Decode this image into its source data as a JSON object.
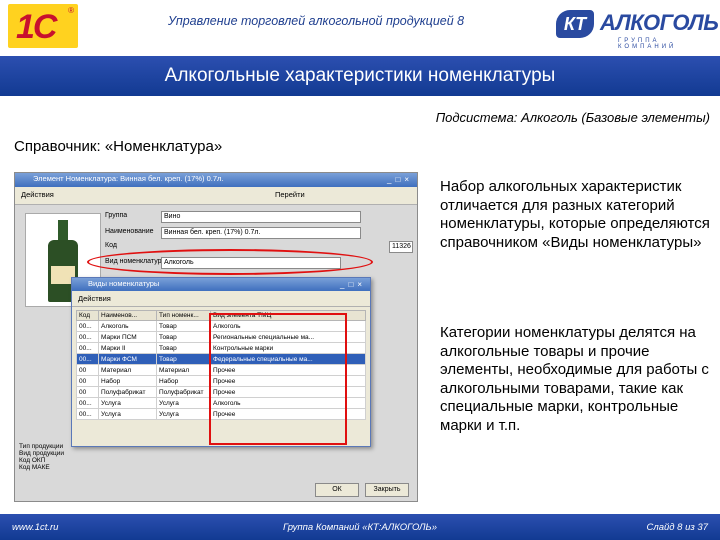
{
  "header": {
    "app_title": "Управление торговлей алкогольной продукцией 8",
    "logo_1c": "1С",
    "logo_kt_badge": "КТ",
    "logo_kt_word": "АЛКОГОЛЬ",
    "logo_kt_sub": "ГРУППА КОМПАНИЙ"
  },
  "page_title": "Алкогольные характеристики номенклатуры",
  "subsystem": "Подсистема: Алкоголь (Базовые элементы)",
  "reference": "Справочник: «Номенклатура»",
  "screenshot": {
    "main_window_title": "Элемент Номенклатура: Винная бел. креп. (17%) 0.7л.",
    "toolbar_actions": "Действия",
    "toolbar_goto": "Перейти",
    "fields": [
      {
        "label": "Группа",
        "value": "Вино"
      },
      {
        "label": "Наименование",
        "value": "Винная бел. креп. (17%) 0.7л."
      },
      {
        "label": "Код",
        "value": "11326"
      },
      {
        "label": "Вид номенклатуры",
        "value": "Алкоголь"
      }
    ],
    "kinds_window_title": "Виды номенклатуры",
    "kinds_toolbar": "Действия",
    "kinds_table": {
      "headers": [
        "Код",
        "Наименов...",
        "Тип номенк...",
        "Вид элемента ТМЦ"
      ],
      "rows": [
        [
          "00...",
          "Алкоголь",
          "Товар",
          "Алкоголь"
        ],
        [
          "00...",
          "Марки ПСМ",
          "Товар",
          "Региональные специальные ма..."
        ],
        [
          "00...",
          "Марки II",
          "Товар",
          "Контрольные марки"
        ],
        [
          "00...",
          "Марки ФСМ",
          "Товар",
          "Федеральные специальные ма..."
        ],
        [
          "00",
          "Материал",
          "Материал",
          "Прочее"
        ],
        [
          "00",
          "Набор",
          "Набор",
          "Прочее"
        ],
        [
          "00",
          "Полуфабрикат",
          "Полуфабрикат",
          "Прочее"
        ],
        [
          "00...",
          "Услуга",
          "Услуга",
          "Алкоголь"
        ],
        [
          "00...",
          "Услуга",
          "Услуга",
          "Прочее"
        ]
      ],
      "selected_row": 3
    },
    "left_labels": [
      "Тип продукции",
      "Вид продукции",
      "Код ОКП",
      "Код МАКЕ"
    ],
    "ok_button": "ОК",
    "close_button": "Закрыть"
  },
  "paragraph1": "Набор алкогольных характеристик отличается для разных категорий номенклатуры, которые определяются справочником «Виды номенклатуры»",
  "paragraph2": "Категории номенклатуры делятся на алкогольные товары и прочие элементы, необходимые для работы с алкогольными товарами, такие как специальные марки, контрольные марки и т.п.",
  "footer": {
    "site": "www.1ct.ru",
    "company": "Группа Компаний «КТ:АЛКОГОЛЬ»",
    "slide": "Слайд 8 из 37"
  },
  "colors": {
    "brand_blue": "#123a92",
    "highlight_red": "#e01010",
    "logo_yellow": "#ffd21f"
  }
}
